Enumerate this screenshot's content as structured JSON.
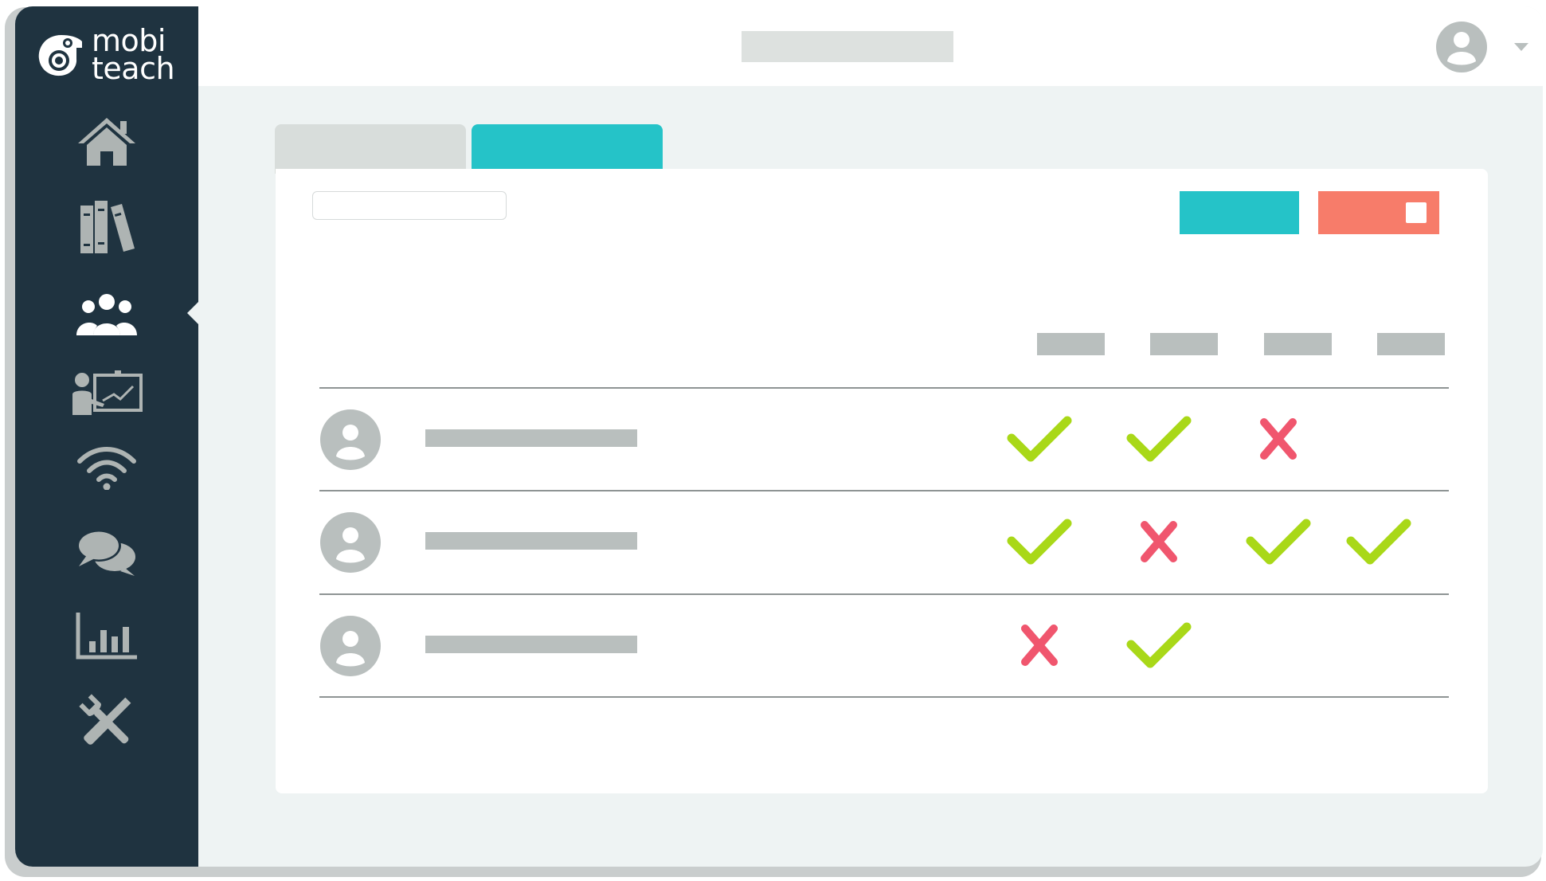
{
  "app": {
    "logo_line1": "mobi",
    "logo_line2": "teach"
  },
  "sidebar": {
    "items": [
      {
        "icon": "home-icon",
        "active": false
      },
      {
        "icon": "library-icon",
        "active": false
      },
      {
        "icon": "students-group-icon",
        "active": true
      },
      {
        "icon": "teacher-presentation-icon",
        "active": false
      },
      {
        "icon": "wifi-icon",
        "active": false
      },
      {
        "icon": "chat-icon",
        "active": false
      },
      {
        "icon": "reports-chart-icon",
        "active": false
      },
      {
        "icon": "tools-icon",
        "active": false
      }
    ]
  },
  "header": {
    "title": "",
    "user_icon": "user-avatar-icon",
    "menu_icon": "chevron-down-icon"
  },
  "tabs": [
    {
      "label": "",
      "active": false
    },
    {
      "label": "",
      "active": true
    }
  ],
  "toolbar": {
    "search_placeholder": "",
    "primary_label": "",
    "stop_icon": "stop-icon"
  },
  "table": {
    "columns": [
      "",
      "",
      "",
      ""
    ],
    "rows": [
      {
        "name": "",
        "marks": [
          "check",
          "check",
          "cross",
          ""
        ]
      },
      {
        "name": "",
        "marks": [
          "check",
          "cross",
          "check",
          "check"
        ]
      },
      {
        "name": "",
        "marks": [
          "cross",
          "check",
          "",
          ""
        ]
      }
    ]
  },
  "colors": {
    "sidebar": "#1f3340",
    "accent": "#25c3c8",
    "stop": "#f77c6a",
    "check": "#a9d818",
    "cross": "#f0566e",
    "placeholder": "#b9bfbe"
  }
}
